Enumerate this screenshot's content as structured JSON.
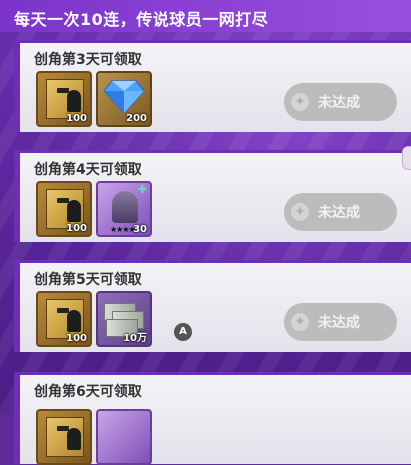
{
  "header": {
    "title": "每天一次10连，传说球员一网打尽"
  },
  "cards": [
    {
      "title": "创角第3天可领取",
      "rewards": [
        {
          "icon": "player-pack-icon",
          "qty": "100"
        },
        {
          "icon": "diamond-icon",
          "qty": "200"
        }
      ],
      "button": "未达成"
    },
    {
      "title": "创角第4天可领取",
      "rewards": [
        {
          "icon": "player-pack-icon",
          "qty": "100"
        },
        {
          "icon": "player-card-icon",
          "stars": "★★★★",
          "qty": "30"
        }
      ],
      "button": "未达成"
    },
    {
      "title": "创角第5天可领取",
      "rewards": [
        {
          "icon": "player-pack-icon",
          "qty": "100"
        },
        {
          "icon": "cash-stack-icon",
          "qty": "10万"
        }
      ],
      "button": "未达成",
      "badge": "A"
    },
    {
      "title": "创角第6天可领取"
    }
  ],
  "colors": {
    "accent": "#6c2fb6",
    "disabled_button": "#bcbcbc"
  }
}
